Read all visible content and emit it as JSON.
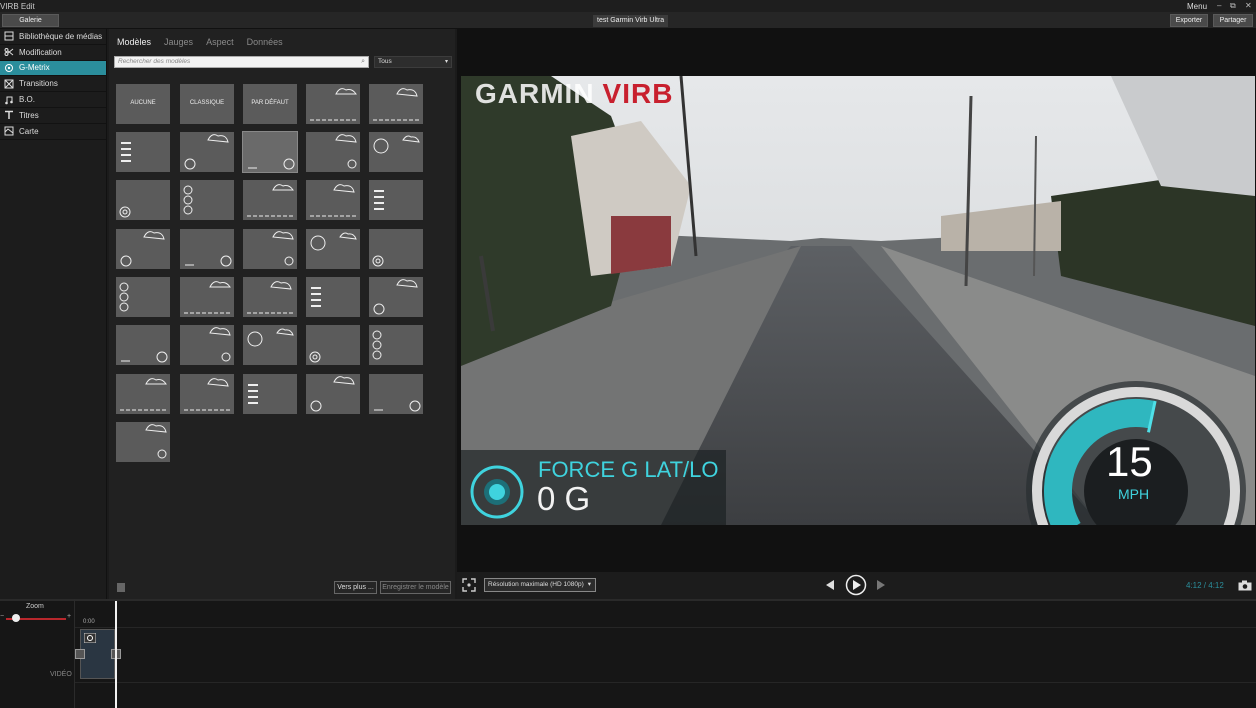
{
  "app": {
    "title": "VIRB Edit",
    "menu_label": "Menu",
    "minimize": "–",
    "restore": "⧉",
    "close": "✕"
  },
  "toolbar": {
    "gallery": "Galerie",
    "project_title": "test Garmin Virb Ultra",
    "export": "Exporter",
    "share": "Partager"
  },
  "sidebar": {
    "items": [
      {
        "label": "Bibliothèque de médias",
        "icon": "film-icon"
      },
      {
        "label": "Modification",
        "icon": "scissors-icon"
      },
      {
        "label": "G-Metrix",
        "icon": "gmetrix-icon",
        "active": true
      },
      {
        "label": "Transitions",
        "icon": "transitions-icon"
      },
      {
        "label": "B.O.",
        "icon": "music-note-icon"
      },
      {
        "label": "Titres",
        "icon": "title-t-icon"
      },
      {
        "label": "Carte",
        "icon": "map-icon"
      }
    ]
  },
  "library": {
    "tabs": [
      "Modèles",
      "Jauges",
      "Aspect",
      "Données"
    ],
    "active_tab": "Modèles",
    "search_placeholder": "Rechercher des modèles",
    "filter_value": "Tous",
    "named_templates": [
      "AUCUNE",
      "CLASSIQUE",
      "PAR DÉFAUT"
    ],
    "more_button": "Vers plus ...",
    "save_button": "Enregistrer le modèle"
  },
  "player": {
    "logo_left": "GARMIN",
    "logo_right": "VIRB",
    "overlay": {
      "label": "FORCE G LAT/LO",
      "value": "0 G"
    },
    "speed": {
      "value": "15",
      "unit": "MPH",
      "level": 0.55
    },
    "resolution": "Résolution maximale (HD 1080p)",
    "time": "4:12 / 4:12"
  },
  "timeline": {
    "zoom_label": "Zoom",
    "minus": "−",
    "plus": "+",
    "start_time": "0:00",
    "track_label": "VIDÉO"
  },
  "colors": {
    "accent": "#2b8e9c",
    "overlay_cyan": "#3fd3de",
    "logo_red": "#c8202e"
  }
}
